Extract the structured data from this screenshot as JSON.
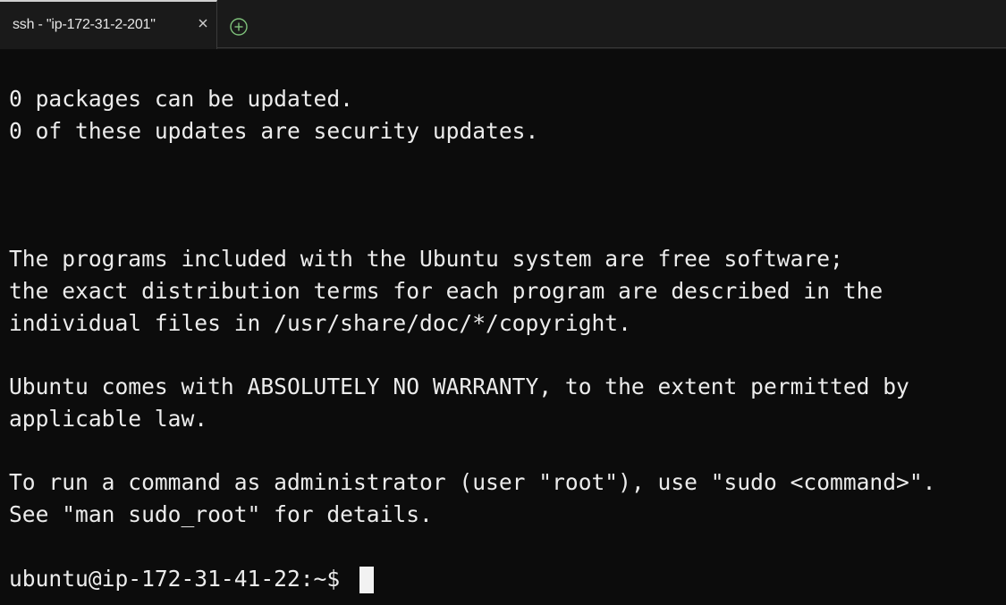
{
  "tab": {
    "title": "ssh - \"ip-172-31-2-201\"",
    "close_icon": "close-icon",
    "new_tab_icon": "plus-circle-icon",
    "new_tab_color": "#7ec07a"
  },
  "terminal": {
    "lines": [
      "0 packages can be updated.",
      "0 of these updates are security updates.",
      "The programs included with the Ubuntu system are free software;",
      "the exact distribution terms for each program are described in the",
      "individual files in /usr/share/doc/*/copyright.",
      "Ubuntu comes with ABSOLUTELY NO WARRANTY, to the extent permitted by",
      "applicable law.",
      "To run a command as administrator (user \"root\"), use \"sudo <command>\".",
      "See \"man sudo_root\" for details.",
      "ubuntu@ip-172-31-41-22:~$"
    ]
  }
}
